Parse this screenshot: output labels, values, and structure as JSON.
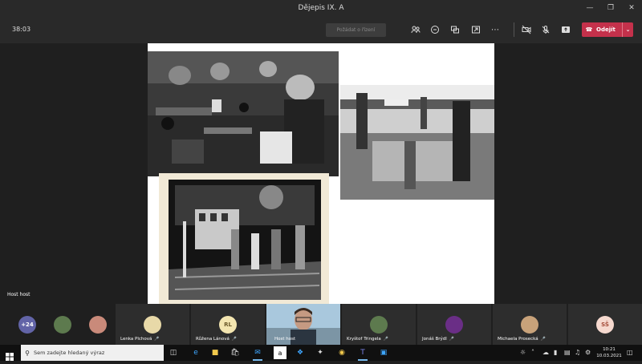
{
  "window": {
    "title": "Dějepis IX. A"
  },
  "toolbar": {
    "timer": "38:03",
    "raise_hand_label": "Požádat o řízení",
    "leave_label": "Odejít"
  },
  "stage": {
    "presenter_name": "Host host"
  },
  "participants": {
    "more_count": "+24",
    "tiles": [
      {
        "name": "Lenka Plchová"
      },
      {
        "name": "Růžena Lánová",
        "initials": "RL"
      },
      {
        "name": "Host host"
      },
      {
        "name": "Kryštof Tringela"
      },
      {
        "name": "Jonáš Brýdl"
      },
      {
        "name": "Michaela Prosecká"
      },
      {
        "initials": "SŠ"
      }
    ]
  },
  "taskbar": {
    "search_placeholder": "Sem zadejte hledaný výraz",
    "time": "10:21",
    "date": "10.03.2021"
  }
}
